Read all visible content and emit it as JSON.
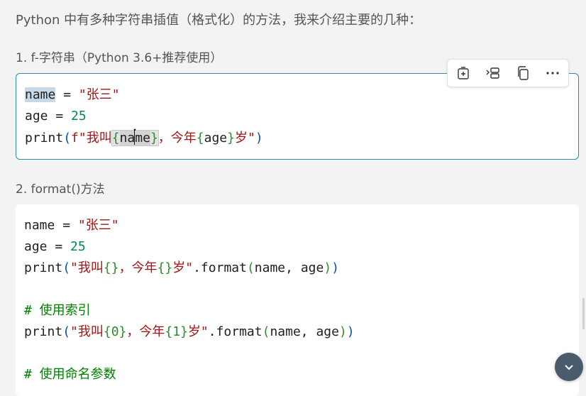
{
  "intro": "Python 中有多种字符串插值（格式化）的方法，我来介绍主要的几种：",
  "section1": {
    "heading": "1. f-字符串（Python 3.6+推荐使用）",
    "code": {
      "l1_var": "name",
      "l1_op": " = ",
      "l1_str": "\"张三\"",
      "l2_var": "age",
      "l2_op": " = ",
      "l2_num": "25",
      "l3_fn": "print",
      "l3_open": "(",
      "l3_str1": "f\"我叫",
      "l3_b1": "{",
      "l3_v1a": "na",
      "l3_v1b": "me",
      "l3_b2": "}",
      "l3_str2": "，今年",
      "l3_b3": "{",
      "l3_v2": "age",
      "l3_b4": "}",
      "l3_str3": "岁\"",
      "l3_close": ")"
    }
  },
  "section2": {
    "heading": "2. format()方法",
    "code": {
      "l1_var": "name",
      "l1_op": " = ",
      "l1_str": "\"张三\"",
      "l2_var": "age",
      "l2_op": " = ",
      "l2_num": "25",
      "l3_fn": "print",
      "l3_open": "(",
      "l3_s1": "\"我叫",
      "l3_f1": "{}",
      "l3_s2": "，今年",
      "l3_f2": "{}",
      "l3_s3": "岁\"",
      "l3_m": ".format",
      "l3_open2": "(",
      "l3_args": "name, age",
      "l3_close2": ")",
      "l3_close": ")",
      "c1": "# 使用索引",
      "l5_fn": "print",
      "l5_open": "(",
      "l5_s1": "\"我叫",
      "l5_f1": "{0}",
      "l5_s2": "，今年",
      "l5_f2": "{1}",
      "l5_s3": "岁\"",
      "l5_m": ".format",
      "l5_open2": "(",
      "l5_args": "name, age",
      "l5_close2": ")",
      "l5_close": ")",
      "c2": "# 使用命名参数"
    }
  },
  "toolbar": {
    "icons": [
      "insert-into-file-icon",
      "split-view-icon",
      "copy-icon",
      "more-icon"
    ]
  },
  "scroll_button": {
    "icon": "chevron-down-icon"
  }
}
